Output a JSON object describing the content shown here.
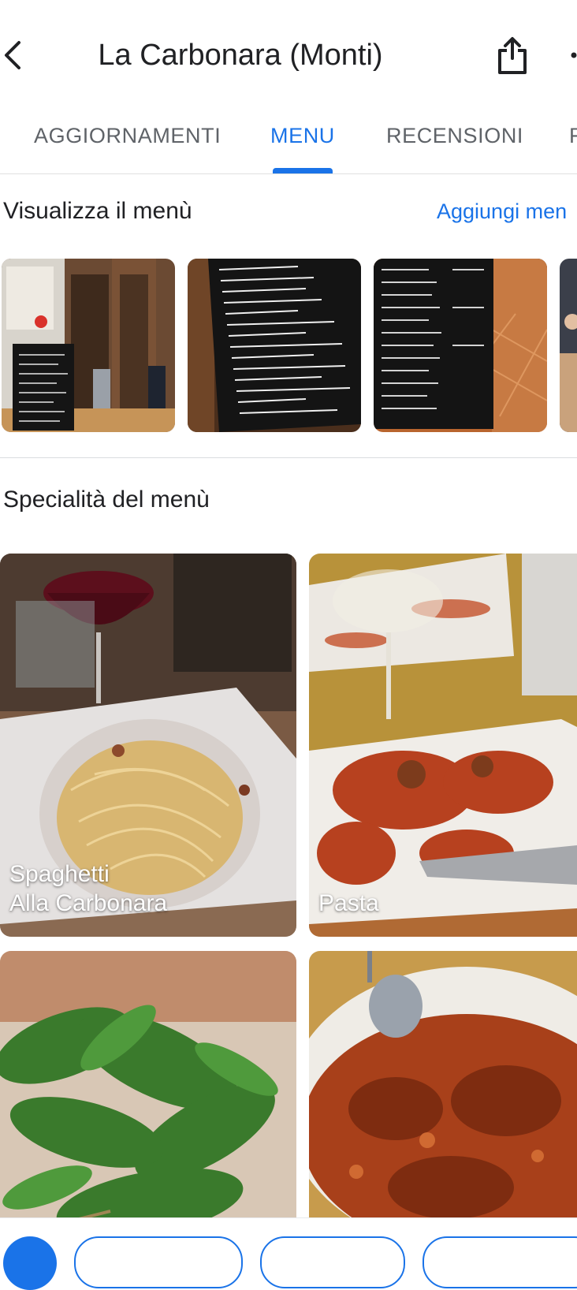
{
  "header": {
    "back_icon": "chevron-left-icon",
    "title": "La Carbonara (Monti)",
    "share_icon": "share-icon",
    "more_icon": "more-vert-icon"
  },
  "tabs": [
    {
      "label": "AGGIORNAMENTI",
      "active": false
    },
    {
      "label": "MENU",
      "active": true
    },
    {
      "label": "RECENSIONI",
      "active": false
    },
    {
      "label": "F",
      "active": false
    }
  ],
  "menu_photos": {
    "title": "Visualizza il menù",
    "add_label": "Aggiungi men"
  },
  "specialties": {
    "title": "Specialità del menù",
    "items": [
      {
        "label_line1": "Spaghetti",
        "label_line2": "Alla Carbonara"
      },
      {
        "label_line1": "",
        "label_line2": "Pasta"
      },
      {
        "label_line1": "",
        "label_line2": ""
      },
      {
        "label_line1": "",
        "label_line2": ""
      }
    ]
  },
  "colors": {
    "accent": "#1a73e8",
    "text": "#202124",
    "tab_inactive": "#5f6368"
  }
}
